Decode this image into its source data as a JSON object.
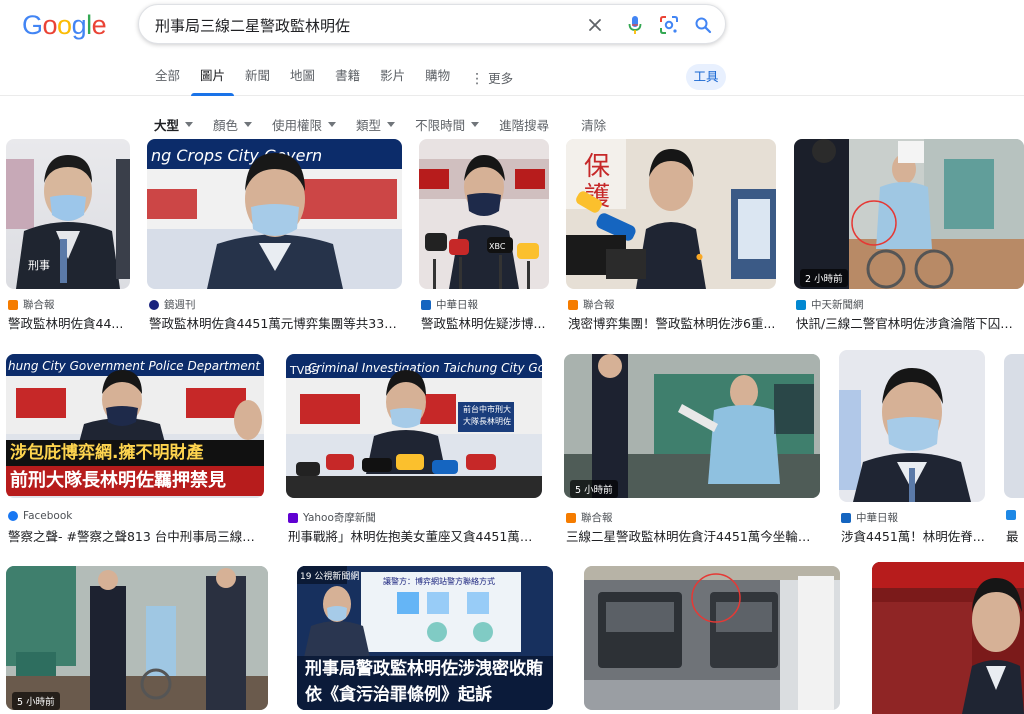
{
  "logo": {
    "letters": [
      "G",
      "o",
      "o",
      "g",
      "l",
      "e"
    ],
    "colors": [
      "#4285f4",
      "#ea4335",
      "#fbbc05",
      "#4285f4",
      "#34a853",
      "#ea4335"
    ]
  },
  "search": {
    "query": "刑事局三線二星警政監林明佐"
  },
  "tabs": [
    {
      "label": "全部"
    },
    {
      "label": "圖片"
    },
    {
      "label": "新聞"
    },
    {
      "label": "地圖"
    },
    {
      "label": "書籍"
    },
    {
      "label": "影片"
    },
    {
      "label": "購物"
    },
    {
      "label": "更多"
    }
  ],
  "tools_label": "工具",
  "filters": [
    {
      "label": "大型"
    },
    {
      "label": "顏色"
    },
    {
      "label": "使用權限"
    },
    {
      "label": "類型"
    },
    {
      "label": "不限時間"
    },
    {
      "label": "進階搜尋"
    },
    {
      "label": "清除"
    }
  ],
  "results": [
    {
      "source": "聯合報",
      "title": "警政監林明佐貪44...",
      "favicon": "#f57c00"
    },
    {
      "source": "鏡週刊",
      "title": "警政監林明佐貪4451萬元博弈集團等共33人...",
      "favicon": "#1a237e"
    },
    {
      "source": "中華日報",
      "title": "警政監林明佐疑涉博...",
      "favicon": "#1565c0"
    },
    {
      "source": "聯合報",
      "title": "洩密博弈集團！警政監林明佐涉6重...",
      "favicon": "#f57c00"
    },
    {
      "source": "中天新聞網",
      "title": "快訊/三線二警官林明佐涉貪淪階下囚羈押5",
      "favicon": "#0288d1",
      "badge": "2 小時前"
    },
    {
      "source": "",
      "title": "警察之聲- #警察之聲813 台中刑事局三線二...",
      "favicon": "#1877f2",
      "banner1": "涉包庇博弈網.擁不明財產",
      "banner2": "前刑大隊長林明佐羈押禁見"
    },
    {
      "source": "Yahoo奇摩新聞",
      "title": "刑事戰將」林明佐抱美女董座又貪4451萬警...",
      "favicon": "#6001d2",
      "sign": "前台中市刑大 大隊長林明佐"
    },
    {
      "source": "聯合報",
      "title": "三線二星警政監林明佐貪汙4451萬今坐輪椅...",
      "favicon": "#f57c00",
      "badge": "5 小時前"
    },
    {
      "source": "中華日報",
      "title": "涉貪4451萬！林明佐脊...",
      "favicon": "#1565c0"
    },
    {
      "source": "",
      "title": "最",
      "favicon": "#1e88e5"
    },
    {
      "source": "Facebook",
      "badge": "5 小時前"
    },
    {
      "banner1": "刑事局警政監林明佐涉洩密收賄",
      "banner2": "依《貪污治罪條例》起訴"
    },
    {},
    {}
  ]
}
